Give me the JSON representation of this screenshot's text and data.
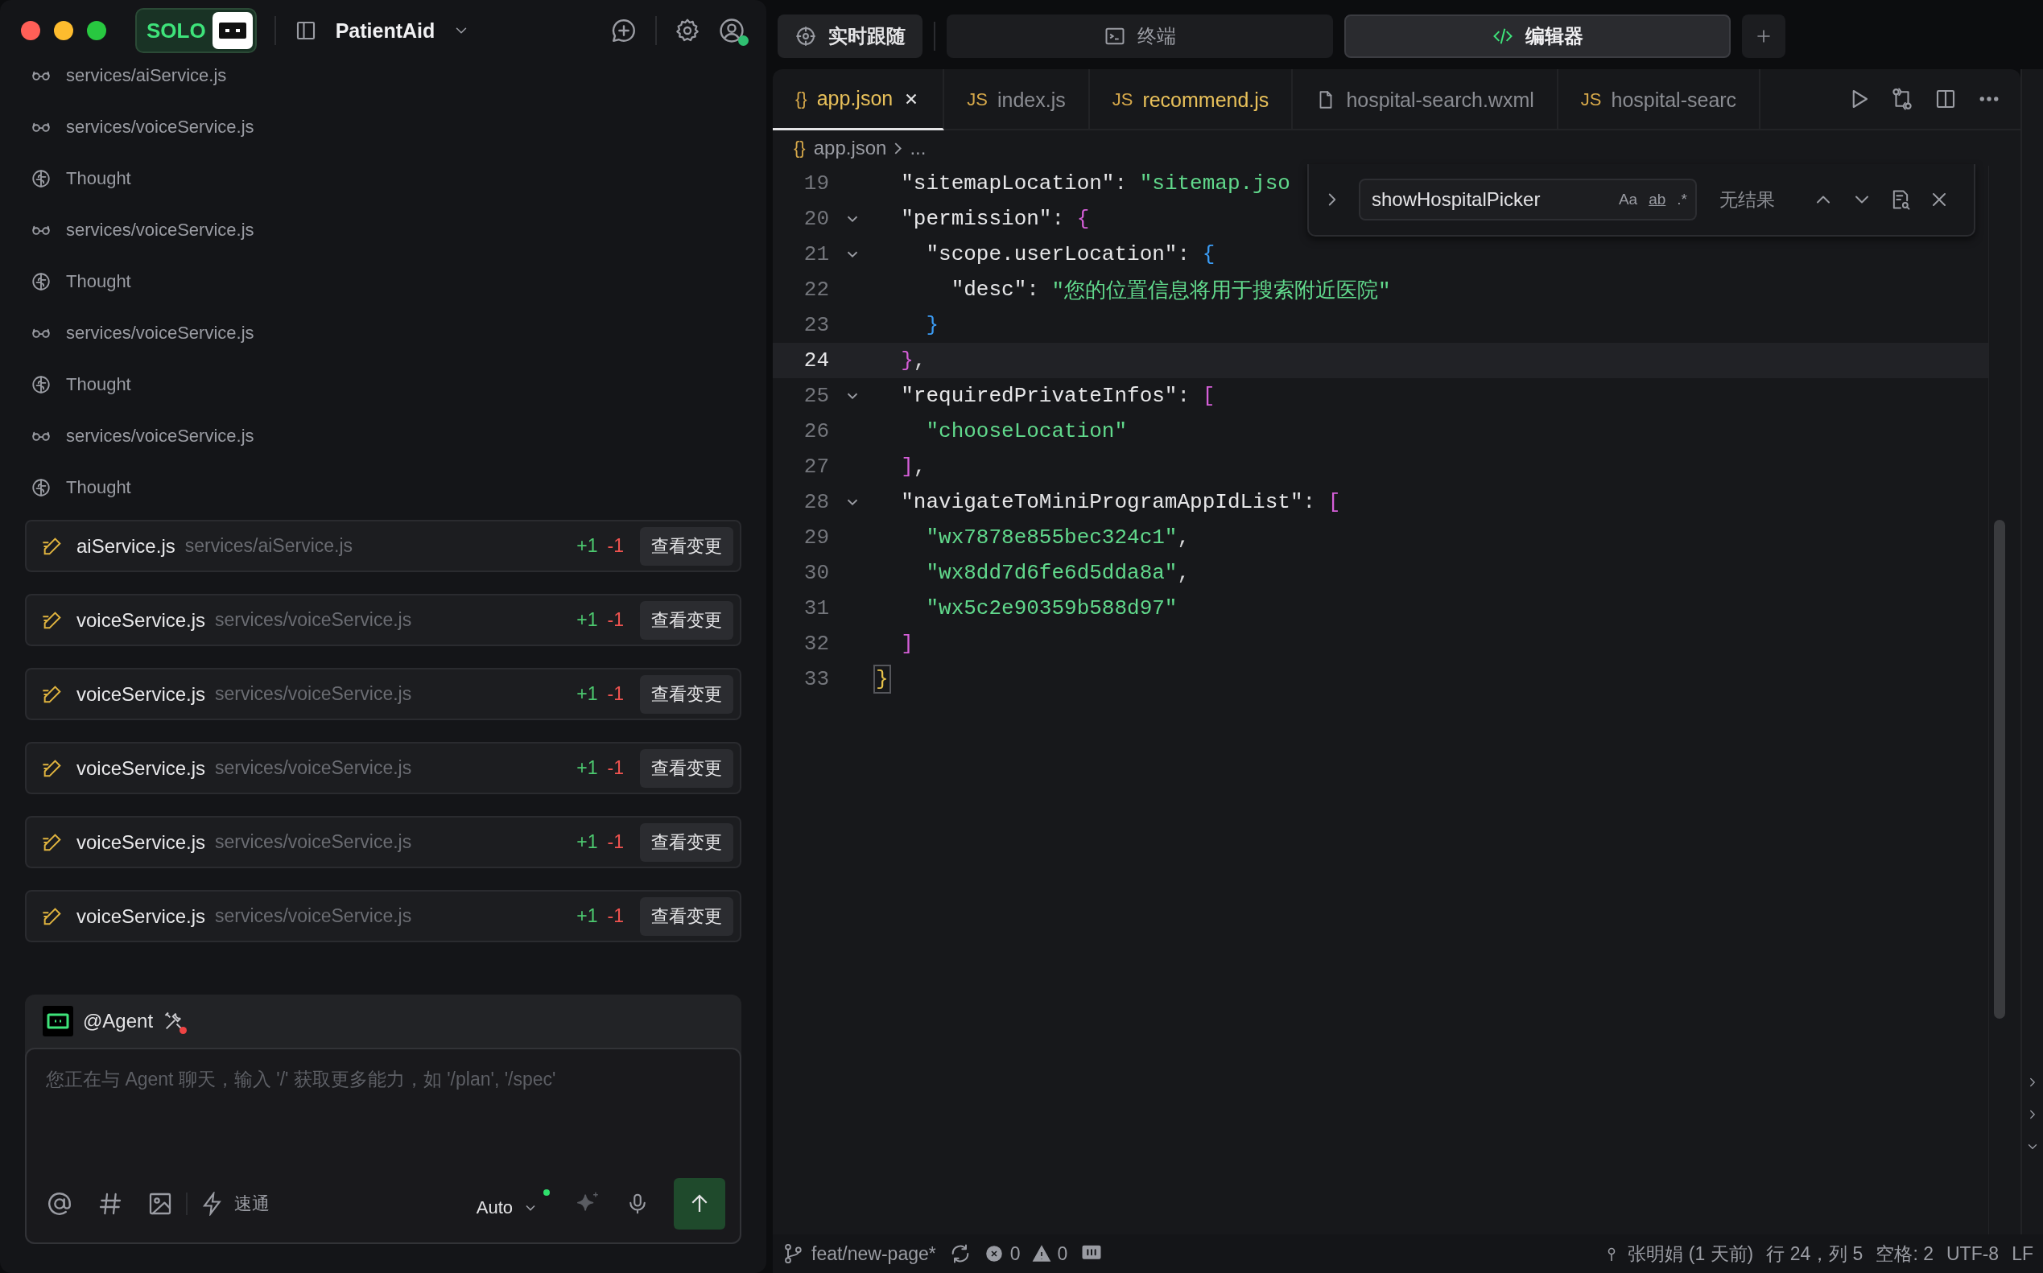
{
  "app_title": {
    "solo_badge": "SOLO",
    "project": "PatientAid"
  },
  "activity": [
    {
      "kind": "read",
      "text": "services/aiService.js"
    },
    {
      "kind": "read",
      "text": "services/voiceService.js"
    },
    {
      "kind": "thought",
      "text": "Thought"
    },
    {
      "kind": "read",
      "text": "services/voiceService.js"
    },
    {
      "kind": "thought",
      "text": "Thought"
    },
    {
      "kind": "read",
      "text": "services/voiceService.js"
    },
    {
      "kind": "thought",
      "text": "Thought"
    },
    {
      "kind": "read",
      "text": "services/voiceService.js"
    },
    {
      "kind": "thought",
      "text": "Thought"
    }
  ],
  "changes": [
    {
      "name": "aiService.js",
      "path": "services/aiService.js",
      "added": "+1",
      "removed": "-1",
      "button": "查看变更"
    },
    {
      "name": "voiceService.js",
      "path": "services/voiceService.js",
      "added": "+1",
      "removed": "-1",
      "button": "查看变更"
    },
    {
      "name": "voiceService.js",
      "path": "services/voiceService.js",
      "added": "+1",
      "removed": "-1",
      "button": "查看变更"
    },
    {
      "name": "voiceService.js",
      "path": "services/voiceService.js",
      "added": "+1",
      "removed": "-1",
      "button": "查看变更"
    },
    {
      "name": "voiceService.js",
      "path": "services/voiceService.js",
      "added": "+1",
      "removed": "-1",
      "button": "查看变更"
    },
    {
      "name": "voiceService.js",
      "path": "services/voiceService.js",
      "added": "+1",
      "removed": "-1",
      "button": "查看变更"
    }
  ],
  "chat": {
    "agent": "@Agent",
    "placeholder": "您正在与 Agent 聊天，输入 '/' 获取更多能力，如 '/plan', '/spec'",
    "mode": "速通",
    "model": "Auto"
  },
  "top_tabs": [
    {
      "label": "实时跟随",
      "kind": "follow",
      "selected": false
    },
    {
      "label": "终端",
      "kind": "terminal",
      "selected": false
    },
    {
      "label": "编辑器",
      "kind": "editor",
      "selected": true
    }
  ],
  "editor_tabs": [
    {
      "icon": "{}",
      "label": "app.json",
      "selected": true,
      "modified": true
    },
    {
      "icon": "JS",
      "label": "index.js",
      "selected": false,
      "modified": false
    },
    {
      "icon": "JS",
      "label": "recommend.js",
      "selected": false,
      "modified": true
    },
    {
      "kind": "file",
      "label": "hospital-search.wxml",
      "selected": false,
      "modified": false
    },
    {
      "icon": "JS",
      "label": "hospital-searc",
      "selected": false,
      "modified": false
    }
  ],
  "breadcrumb": {
    "icon": "{}",
    "file": "app.json",
    "rest": "..."
  },
  "code": [
    {
      "number": "19",
      "fold": false,
      "current": false,
      "tokens": [
        {
          "kind": "key",
          "text": "  \"sitemapLocation\""
        },
        {
          "kind": "punct",
          "text": ": "
        },
        {
          "kind": "string",
          "text": "\"sitemap.jso"
        }
      ]
    },
    {
      "number": "20",
      "fold": true,
      "current": false,
      "tokens": [
        {
          "kind": "key",
          "text": "  \"permission\""
        },
        {
          "kind": "punct",
          "text": ": "
        },
        {
          "kind": "bracket",
          "text": "{",
          "color": "#d65fd9"
        }
      ]
    },
    {
      "number": "21",
      "fold": true,
      "current": false,
      "tokens": [
        {
          "kind": "key",
          "text": "    \"scope.userLocation\""
        },
        {
          "kind": "punct",
          "text": ": "
        },
        {
          "kind": "bracket",
          "text": "{",
          "color": "#3b9cf5"
        }
      ]
    },
    {
      "number": "22",
      "fold": false,
      "current": false,
      "tokens": [
        {
          "kind": "key",
          "text": "      \"desc\""
        },
        {
          "kind": "punct",
          "text": ": "
        },
        {
          "kind": "string",
          "text": "\"您的位置信息将用于搜索附近医院\""
        }
      ]
    },
    {
      "number": "23",
      "fold": false,
      "current": false,
      "tokens": [
        {
          "kind": "bracket",
          "text": "    }",
          "color": "#3b9cf5"
        }
      ]
    },
    {
      "number": "24",
      "fold": false,
      "current": true,
      "tokens": [
        {
          "kind": "bracket",
          "text": "  }",
          "color": "#d65fd9"
        },
        {
          "kind": "punct",
          "text": ","
        }
      ]
    },
    {
      "number": "25",
      "fold": true,
      "current": false,
      "tokens": [
        {
          "kind": "key",
          "text": "  \"requiredPrivateInfos\""
        },
        {
          "kind": "punct",
          "text": ": "
        },
        {
          "kind": "bracket",
          "text": "[",
          "color": "#d65fd9"
        }
      ]
    },
    {
      "number": "26",
      "fold": false,
      "current": false,
      "tokens": [
        {
          "kind": "string",
          "text": "    \"chooseLocation\""
        }
      ]
    },
    {
      "number": "27",
      "fold": false,
      "current": false,
      "tokens": [
        {
          "kind": "bracket",
          "text": "  ]",
          "color": "#d65fd9"
        },
        {
          "kind": "punct",
          "text": ","
        }
      ]
    },
    {
      "number": "28",
      "fold": true,
      "current": false,
      "tokens": [
        {
          "kind": "key",
          "text": "  \"navigateToMiniProgramAppIdList\""
        },
        {
          "kind": "punct",
          "text": ": "
        },
        {
          "kind": "bracket",
          "text": "[",
          "color": "#d65fd9"
        }
      ]
    },
    {
      "number": "29",
      "fold": false,
      "current": false,
      "tokens": [
        {
          "kind": "string",
          "text": "    \"wx7878e855bec324c1\""
        },
        {
          "kind": "punct",
          "text": ","
        }
      ]
    },
    {
      "number": "30",
      "fold": false,
      "current": false,
      "tokens": [
        {
          "kind": "string",
          "text": "    \"wx8dd7d6fe6d5dda8a\""
        },
        {
          "kind": "punct",
          "text": ","
        }
      ]
    },
    {
      "number": "31",
      "fold": false,
      "current": false,
      "tokens": [
        {
          "kind": "string",
          "text": "    \"wx5c2e90359b588d97\""
        }
      ]
    },
    {
      "number": "32",
      "fold": false,
      "current": false,
      "tokens": [
        {
          "kind": "bracket",
          "text": "  ]",
          "color": "#d65fd9"
        }
      ]
    },
    {
      "number": "33",
      "fold": false,
      "current": false,
      "tokens": [
        {
          "kind": "bracket",
          "text": "}",
          "color": "#e8c34a",
          "matched": true
        }
      ]
    }
  ],
  "find": {
    "value": "showHospitalPicker",
    "options": [
      "Aa",
      "ab",
      ".*"
    ],
    "result": "无结果"
  },
  "status_bar": {
    "branch": "feat/new-page*",
    "errors": "0",
    "warnings": "0",
    "blame": "张明娟 (1 天前)",
    "position": "行 24，列 5",
    "indent": "空格: 2",
    "encoding": "UTF-8",
    "eol": "LF"
  }
}
